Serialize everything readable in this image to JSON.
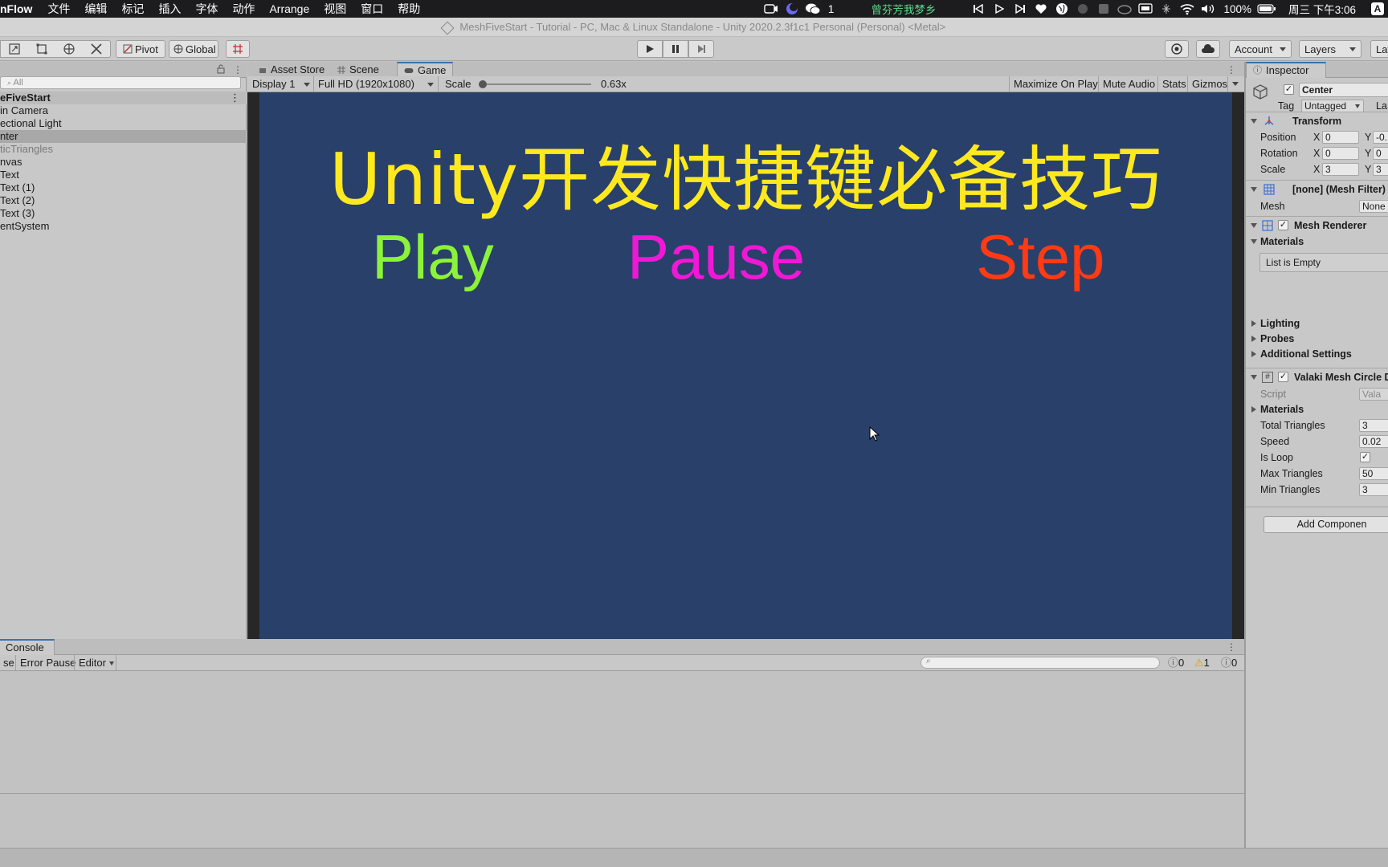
{
  "menubar": {
    "app": "nFlow",
    "items": [
      "文件",
      "编辑",
      "标记",
      "插入",
      "字体",
      "动作",
      "Arrange",
      "视图",
      "窗口",
      "帮助"
    ],
    "wechat_count": "1",
    "user_text": "曾芬芳我梦乡",
    "battery": "100%",
    "clock": "周三 下午3:06",
    "input_method": "A"
  },
  "window": {
    "title": "MeshFiveStart - Tutorial - PC, Mac & Linux Standalone - Unity 2020.2.3f1c1 Personal (Personal) <Metal>"
  },
  "toolbar": {
    "pivot": "Pivot",
    "global": "Global",
    "account": "Account",
    "layers": "Layers",
    "layout": "Lay"
  },
  "hierarchy": {
    "search_placeholder": "All",
    "scene": "eFiveStart",
    "items": [
      {
        "label": "in Camera",
        "state": "normal"
      },
      {
        "label": "ectional Light",
        "state": "normal"
      },
      {
        "label": "nter",
        "state": "selected"
      },
      {
        "label": "ticTriangles",
        "state": "inactive"
      },
      {
        "label": "nvas",
        "state": "normal"
      },
      {
        "label": "Text",
        "state": "normal"
      },
      {
        "label": "Text (1)",
        "state": "normal"
      },
      {
        "label": "Text (2)",
        "state": "normal"
      },
      {
        "label": "Text (3)",
        "state": "normal"
      },
      {
        "label": "entSystem",
        "state": "normal"
      }
    ]
  },
  "tabs": {
    "asset_store": "Asset Store",
    "scene": "Scene",
    "game": "Game"
  },
  "game_bar": {
    "display": "Display 1",
    "resolution": "Full HD (1920x1080)",
    "scale_label": "Scale",
    "scale_value": "0.63x",
    "scale_level": 0.0,
    "maximize": "Maximize On Play",
    "mute": "Mute Audio",
    "stats": "Stats",
    "gizmos": "Gizmos"
  },
  "game_view": {
    "title": "Unity开发快捷键必备技巧",
    "play": "Play",
    "pause": "Pause",
    "step": "Step",
    "colors": {
      "background": "#28406a",
      "title": "#ffe91e",
      "play": "#8cf23a",
      "pause": "#f018d6",
      "step": "#ff3a14"
    }
  },
  "console": {
    "tab": "Console",
    "clear_fragment": "se",
    "error_pause": "Error Pause",
    "editor": "Editor",
    "info_count": "0",
    "warning_count": "1",
    "error_count": "0"
  },
  "inspector": {
    "tab": "Inspector",
    "object_name": "Center",
    "tag_label": "Tag",
    "tag_value": "Untagged",
    "layer_fragment": "La",
    "transform": {
      "title": "Transform",
      "rows": [
        {
          "label": "Position",
          "x": "0",
          "y": "-0."
        },
        {
          "label": "Rotation",
          "x": "0",
          "y": "0"
        },
        {
          "label": "Scale",
          "x": "3",
          "y": "3"
        }
      ]
    },
    "mesh_filter": {
      "title": "[none] (Mesh Filter)",
      "mesh_label": "Mesh",
      "mesh_value": "None"
    },
    "mesh_renderer": {
      "title": "Mesh Renderer",
      "materials": "Materials",
      "list_empty": "List is Empty",
      "lighting": "Lighting",
      "probes": "Probes",
      "additional": "Additional Settings"
    },
    "script": {
      "title": "Valaki Mesh Circle D",
      "script_label": "Script",
      "script_value": "Vala",
      "materials": "Materials",
      "fields": [
        {
          "label": "Total Triangles",
          "value": "3"
        },
        {
          "label": "Speed",
          "value": "0.02"
        },
        {
          "label": "Is Loop",
          "value": "✓"
        },
        {
          "label": "Max Triangles",
          "value": "50"
        },
        {
          "label": "Min Triangles",
          "value": "3"
        }
      ]
    },
    "add_component": "Add Componen"
  }
}
